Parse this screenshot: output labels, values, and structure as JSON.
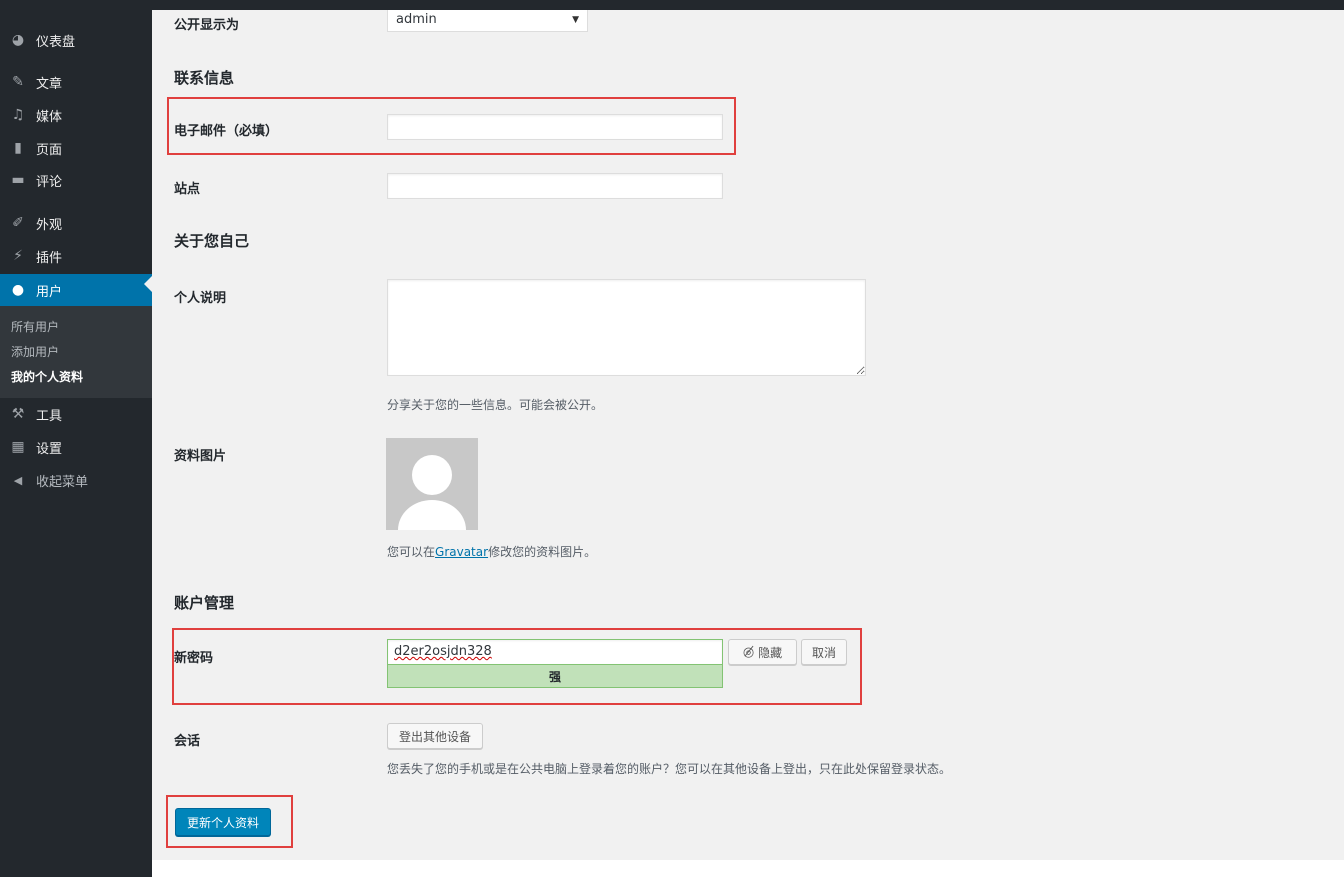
{
  "sidebar": {
    "items": [
      {
        "icon": "dashboard-icon",
        "glyph": "◕",
        "label": "仪表盘"
      },
      {
        "icon": "pin-icon",
        "glyph": "✎",
        "label": "文章"
      },
      {
        "icon": "media-icon",
        "glyph": "♫",
        "label": "媒体"
      },
      {
        "icon": "page-icon",
        "glyph": "▮",
        "label": "页面"
      },
      {
        "icon": "comment-icon",
        "glyph": "▬",
        "label": "评论"
      },
      {
        "icon": "appearance-icon",
        "glyph": "✐",
        "label": "外观"
      },
      {
        "icon": "plugin-icon",
        "glyph": "⚡",
        "label": "插件"
      },
      {
        "icon": "users-icon",
        "glyph": "●",
        "label": "用户"
      },
      {
        "icon": "tools-icon",
        "glyph": "⚒",
        "label": "工具"
      },
      {
        "icon": "settings-icon",
        "glyph": "▦",
        "label": "设置"
      },
      {
        "icon": "collapse-icon",
        "glyph": "◀",
        "label": "收起菜单"
      }
    ],
    "submenu": [
      "所有用户",
      "添加用户",
      "我的个人资料"
    ]
  },
  "form": {
    "display_name_label": "公开显示为",
    "display_name_value": "admin",
    "contact_heading": "联系信息",
    "email_label": "电子邮件（必填）",
    "email_value": "",
    "website_label": "站点",
    "website_value": "",
    "about_heading": "关于您自己",
    "bio_label": "个人说明",
    "bio_value": "",
    "bio_desc": "分享关于您的一些信息。可能会被公开。",
    "picture_label": "资料图片",
    "picture_desc_before": "您可以在",
    "picture_desc_link": "Gravatar",
    "picture_desc_after": "修改您的资料图片。",
    "account_heading": "账户管理",
    "password_label": "新密码",
    "password_value": "d2er2osjdn328",
    "hide_button": "隐藏",
    "cancel_button": "取消",
    "strength_label": "强",
    "sessions_label": "会话",
    "logout_others_button": "登出其他设备",
    "sessions_desc": "您丢失了您的手机或是在公共电脑上登录着您的账户？您可以在其他设备上登出，只在此处保留登录状态。",
    "submit_button": "更新个人资料"
  },
  "colors": {
    "sidebar_bg": "#23282d",
    "sidebar_current": "#0073aa",
    "primary_button": "#0085ba",
    "strength_strong": "#c1e1b9",
    "annotation_red": "#e0403e"
  }
}
